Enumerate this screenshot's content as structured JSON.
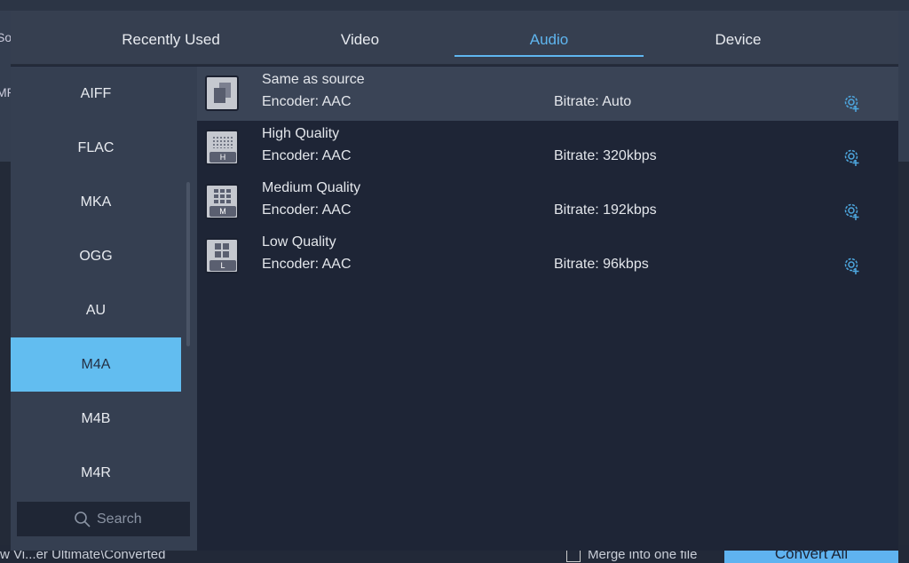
{
  "background": {
    "left_partial": [
      "So",
      "MP"
    ],
    "bottom": {
      "path": "w Vi...er Ultimate\\Converted",
      "merge_label": "Merge into one file",
      "convert_all": "Convert All"
    }
  },
  "tabs": [
    {
      "label": "Recently Used"
    },
    {
      "label": "Video"
    },
    {
      "label": "Audio",
      "active": true
    },
    {
      "label": "Device"
    }
  ],
  "formats": [
    {
      "label": "AIFF"
    },
    {
      "label": "FLAC"
    },
    {
      "label": "MKA"
    },
    {
      "label": "OGG"
    },
    {
      "label": "AU"
    },
    {
      "label": "M4A",
      "active": true
    },
    {
      "label": "M4B"
    },
    {
      "label": "M4R"
    }
  ],
  "search": {
    "placeholder": "Search"
  },
  "presets": [
    {
      "name": "Same as source",
      "encoder": "Encoder: AAC",
      "bitrate": "Bitrate: Auto",
      "icon": "copy-icon",
      "selected": true
    },
    {
      "name": "High Quality",
      "encoder": "Encoder: AAC",
      "bitrate": "Bitrate: 320kbps",
      "icon": "quality-high-icon",
      "badge": "H"
    },
    {
      "name": "Medium Quality",
      "encoder": "Encoder: AAC",
      "bitrate": "Bitrate: 192kbps",
      "icon": "quality-medium-icon",
      "badge": "M"
    },
    {
      "name": "Low Quality",
      "encoder": "Encoder: AAC",
      "bitrate": "Bitrate: 96kbps",
      "icon": "quality-low-icon",
      "badge": "L"
    }
  ],
  "colors": {
    "accent": "#5fb6f0",
    "panel": "#1e2536",
    "sidebar": "#353f51"
  }
}
